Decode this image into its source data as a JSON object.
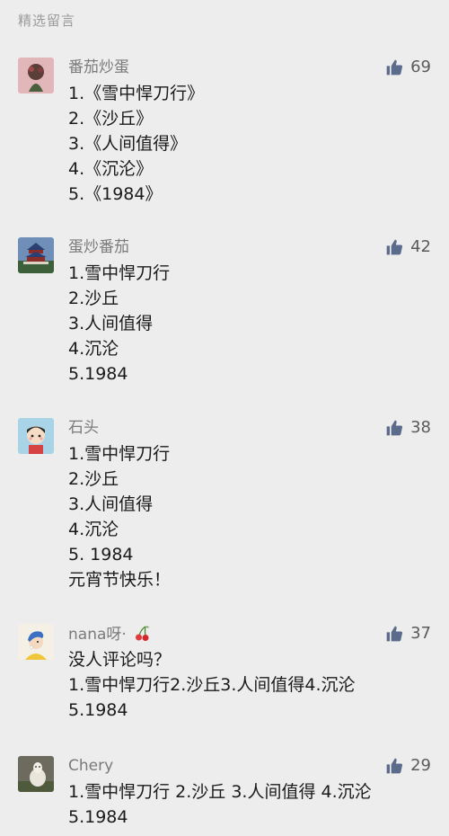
{
  "section_title": "精选留言",
  "comments": [
    {
      "nickname": "番茄炒蛋",
      "likes": "69",
      "avatar": "flower-avatar",
      "lines": [
        "1.《雪中悍刀行》",
        "2.《沙丘》",
        "3.《人间值得》",
        "4.《沉沦》",
        "5.《1984》"
      ]
    },
    {
      "nickname": "蛋炒番茄",
      "likes": "42",
      "avatar": "temple-of-heaven-avatar",
      "lines": [
        "1.雪中悍刀行",
        "2.沙丘",
        "3.人间值得",
        "4.沉沦",
        "5.1984"
      ]
    },
    {
      "nickname": "石头",
      "likes": "38",
      "avatar": "cartoon-boy-avatar",
      "lines": [
        "1.雪中悍刀行",
        "2.沙丘",
        "3.人间值得",
        "4.沉沦",
        "5. 1984",
        "元宵节快乐！"
      ]
    },
    {
      "nickname": "nana呀·",
      "likes": "37",
      "avatar": "girl-with-pearl-earring-avatar",
      "lines": [
        "没人评论吗？",
        "1.雪中悍刀行2.沙丘3.人间值得4.沉沦",
        "5.1984"
      ]
    },
    {
      "nickname": "Chery",
      "likes": "29",
      "avatar": "alpaca-avatar",
      "lines": [
        "1.雪中悍刀行 2.沙丘 3.人间值得 4.沉沦",
        "5.1984"
      ]
    }
  ],
  "icons": {
    "like": "thumbs-up-icon",
    "cherry": "cherry-icon"
  },
  "colors": {
    "background": "#ededed",
    "nickname": "#7a7a7a",
    "like_icon": "#5b6b8c"
  }
}
